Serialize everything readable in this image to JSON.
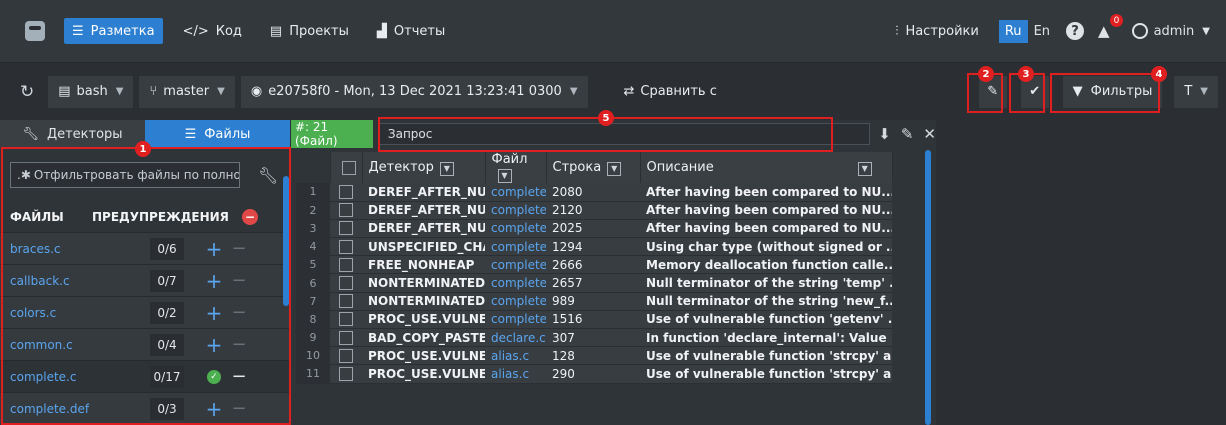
{
  "topnav": {
    "items": [
      {
        "label": "Разметка",
        "icon": "layout-icon"
      },
      {
        "label": "Код",
        "icon": "code-icon"
      },
      {
        "label": "Проекты",
        "icon": "projects-icon"
      },
      {
        "label": "Отчеты",
        "icon": "reports-icon"
      }
    ],
    "settings_label": "Настройки",
    "lang_ru": "Ru",
    "lang_en": "En",
    "notif_count": "0",
    "user": "admin"
  },
  "toolbar": {
    "shell": "bash",
    "branch": "master",
    "commit": "e20758f0 - Mon, 13 Dec 2021 13:23:41 0300",
    "compare_label": "Сравнить с",
    "filters_label": "Фильтры"
  },
  "annotations": [
    "1",
    "2",
    "3",
    "4",
    "5"
  ],
  "left": {
    "tab_detectors": "Детекторы",
    "tab_files": "Файлы",
    "filter_placeholder": "Отфильтровать файлы по полно",
    "col_files": "ФАЙЛЫ",
    "col_warnings": "ПРЕДУПРЕЖДЕНИЯ",
    "files": [
      {
        "name": "braces.c",
        "count": "0/6",
        "state": "plus"
      },
      {
        "name": "callback.c",
        "count": "0/7",
        "state": "plus"
      },
      {
        "name": "colors.c",
        "count": "0/2",
        "state": "plus"
      },
      {
        "name": "common.c",
        "count": "0/4",
        "state": "plus"
      },
      {
        "name": "complete.c",
        "count": "0/17",
        "state": "ok"
      },
      {
        "name": "complete.def",
        "count": "0/3",
        "state": "plus"
      }
    ]
  },
  "main": {
    "found_badge": "#: 21 (Файл)",
    "query_placeholder": "Запрос",
    "headers": {
      "detector": "Детектор",
      "file": "Файл",
      "line": "Строка",
      "desc": "Описание"
    },
    "rows": [
      {
        "n": "1",
        "det": "DEREF_AFTER_NULL",
        "file": "complete.c",
        "line": "2080",
        "desc": "After having been compared to NU..."
      },
      {
        "n": "2",
        "det": "DEREF_AFTER_NULL",
        "file": "complete.c",
        "line": "2120",
        "desc": "After having been compared to NU..."
      },
      {
        "n": "3",
        "det": "DEREF_AFTER_NULL",
        "file": "complete.c",
        "line": "2025",
        "desc": "After having been compared to NU..."
      },
      {
        "n": "4",
        "det": "UNSPECIFIED_CHAR",
        "file": "complete.c",
        "line": "1294",
        "desc": "Using char type (without signed or ..."
      },
      {
        "n": "5",
        "det": "FREE_NONHEAP",
        "file": "complete.c",
        "line": "2666",
        "desc": "Memory deallocation function calle..."
      },
      {
        "n": "6",
        "det": "NONTERMINATED",
        "file": "complete.c",
        "line": "2657",
        "desc": "Null terminator of the string 'temp' ..."
      },
      {
        "n": "7",
        "det": "NONTERMINATED",
        "file": "complete.c",
        "line": "989",
        "desc": "Null terminator of the string 'new_f..."
      },
      {
        "n": "8",
        "det": "PROC_USE.VULNERABLE",
        "file": "complete.c",
        "line": "1516",
        "desc": "Use of vulnerable function 'getenv' ..."
      },
      {
        "n": "9",
        "det": "BAD_COPY_PASTE",
        "file": "declare.c",
        "line": "307",
        "desc": "In function 'declare_internal': Value ..."
      },
      {
        "n": "10",
        "det": "PROC_USE.VULNERABLE",
        "file": "alias.c",
        "line": "128",
        "desc": "Use of vulnerable function 'strcpy' a..."
      },
      {
        "n": "11",
        "det": "PROC_USE.VULNERABLE",
        "file": "alias.c",
        "line": "290",
        "desc": "Use of vulnerable function 'strcpy' a..."
      }
    ]
  }
}
